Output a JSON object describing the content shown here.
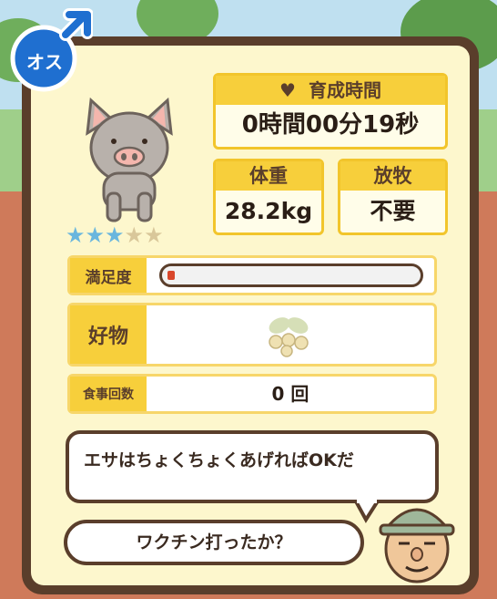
{
  "gender": {
    "label": "オス"
  },
  "pig": {
    "rating": 3,
    "max_rating": 5
  },
  "growth_time": {
    "label": "育成時間",
    "value": "0時間00分19秒"
  },
  "weight": {
    "label": "体重",
    "value": "28.2kg"
  },
  "grazing": {
    "label": "放牧",
    "value": "不要"
  },
  "satisfaction": {
    "label": "満足度",
    "level": 0.03
  },
  "favorite": {
    "label": "好物"
  },
  "meals": {
    "label": "食事回数",
    "value": "0 回"
  },
  "farmer_speech": "エサはちょくちょくあげればOKだ",
  "player_speech": "ワクチン打ったか？",
  "colors": {
    "accent": "#f7cf3b",
    "frame": "#5a3e2b",
    "star_on": "#6ab6de",
    "star_off": "#d9c79a",
    "bar_fill": "#d9472b"
  }
}
